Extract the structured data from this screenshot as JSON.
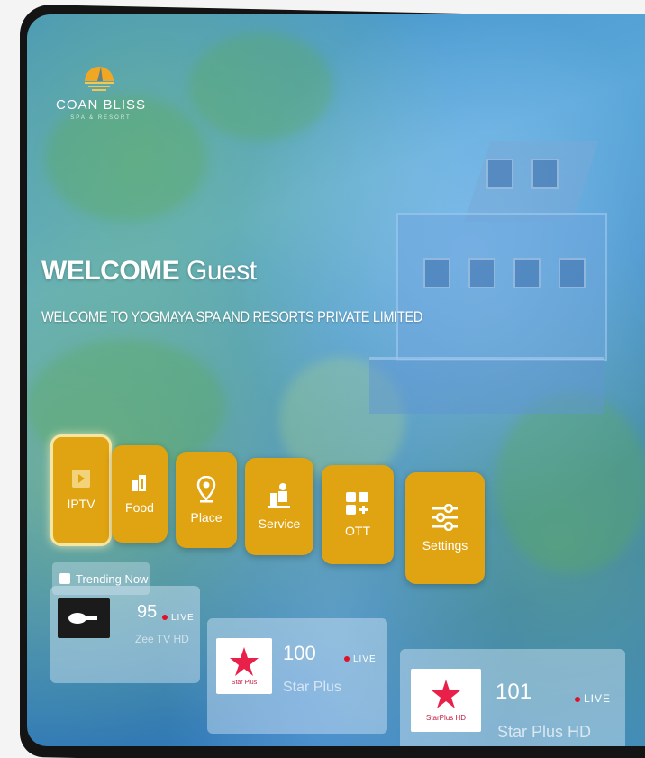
{
  "brand": {
    "name": "COAN BLISS",
    "tagline": "SPA & RESORT"
  },
  "header": {
    "welcome_bold": "WELCOME",
    "welcome_rest": "Guest",
    "subtitle": "WELCOME TO YOGMAYA SPA AND RESORTS PRIVATE LIMITED"
  },
  "menu": {
    "tiles": [
      {
        "label": "IPTV",
        "icon": "play-icon",
        "selected": true
      },
      {
        "label": "Food",
        "icon": "food-icon"
      },
      {
        "label": "Place",
        "icon": "location-pin-icon"
      },
      {
        "label": "Service",
        "icon": "bellboy-icon"
      },
      {
        "label": "OTT",
        "icon": "apps-grid-icon"
      },
      {
        "label": "Settings",
        "icon": "sliders-icon"
      }
    ]
  },
  "trending": {
    "label": "Trending Now"
  },
  "channels": [
    {
      "number": "95",
      "name": "Zee TV HD",
      "live": "LIVE"
    },
    {
      "number": "100",
      "name": "Star Plus",
      "live": "LIVE",
      "logo_text": "Star Plus"
    },
    {
      "number": "101",
      "name": "Star Plus HD",
      "live": "LIVE",
      "logo_text": "StarPlus HD"
    }
  ],
  "colors": {
    "tile_accent": "#e0a412",
    "live_dot": "#e0102a"
  }
}
